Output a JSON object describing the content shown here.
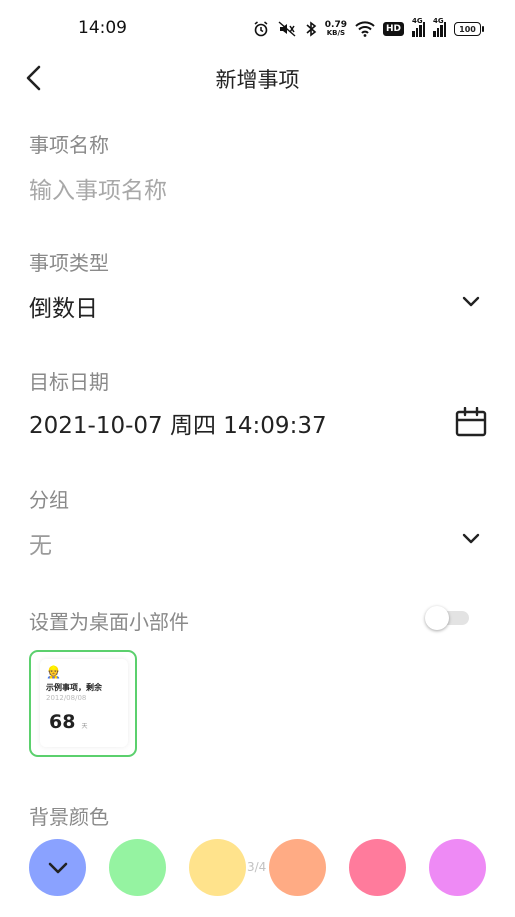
{
  "status_bar": {
    "time": "14:09",
    "speed_value": "0.79",
    "speed_unit": "KB/S",
    "hd_label": "HD",
    "signal1_label": "4G",
    "signal2_label": "4G",
    "battery": "100",
    "icons": [
      "alarm-icon",
      "mute-icon",
      "bluetooth-icon",
      "wifi-icon",
      "hd-icon",
      "signal-icon",
      "signal-icon",
      "battery-icon"
    ]
  },
  "header": {
    "title": "新增事项",
    "back_icon": "back-icon"
  },
  "fields": {
    "name": {
      "label": "事项名称",
      "placeholder": "输入事项名称"
    },
    "type": {
      "label": "事项类型",
      "value": "倒数日",
      "icon": "chevron-down-icon"
    },
    "date": {
      "label": "目标日期",
      "value": "2021-10-07 周四 14:09:37",
      "icon": "calendar-icon"
    },
    "group": {
      "label": "分组",
      "value": "无",
      "icon": "chevron-down-icon"
    },
    "widget": {
      "label": "设置为桌面小部件",
      "enabled": false
    }
  },
  "widget_preview": {
    "emoji": "👷",
    "title": "示例事项，剩余",
    "date": "2012/08/08",
    "days": "68",
    "unit": "天",
    "border_color": "#5bd06d"
  },
  "background": {
    "label": "背景颜色",
    "selected_index": 0,
    "swatches": [
      "#8aa2ff",
      "#95f3a1",
      "#ffe38c",
      "#ffab84",
      "#ff7b9c",
      "#ee8af5"
    ],
    "page_indicator": "3/4"
  }
}
